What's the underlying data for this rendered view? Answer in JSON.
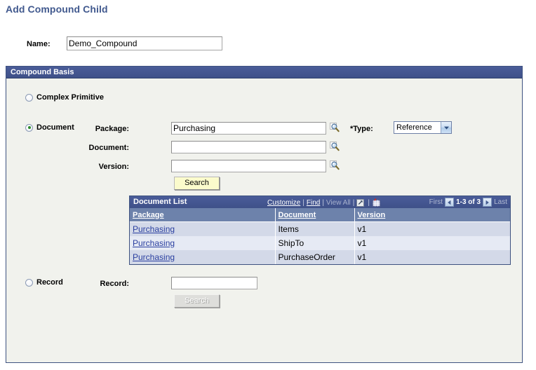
{
  "page": {
    "title": "Add Compound Child"
  },
  "name_field": {
    "label": "Name:",
    "value": "Demo_Compound",
    "placeholder": ""
  },
  "groupbox": {
    "title": "Compound Basis"
  },
  "options": {
    "complex_primitive": {
      "label": "Complex Primitive",
      "selected": false
    },
    "document": {
      "label": "Document",
      "selected": true
    },
    "record": {
      "label": "Record",
      "selected": false
    }
  },
  "document_section": {
    "package": {
      "label": "Package:",
      "value": "Purchasing",
      "placeholder": "",
      "lookup_icon": "magnifier-icon"
    },
    "document": {
      "label": "Document:",
      "value": "",
      "placeholder": "",
      "lookup_icon": "magnifier-icon"
    },
    "version": {
      "label": "Version:",
      "value": "",
      "placeholder": "",
      "lookup_icon": "magnifier-icon"
    },
    "type": {
      "label": "*Type:",
      "value": "Reference",
      "options": [
        "Reference"
      ],
      "arrow_icon": "chevron-down-icon"
    },
    "search_button": {
      "label": "Search",
      "enabled": true
    }
  },
  "record_section": {
    "record": {
      "label": "Record:",
      "value": "",
      "placeholder": ""
    },
    "search_button": {
      "label": "Search",
      "enabled": false
    }
  },
  "document_list": {
    "title": "Document List",
    "tools": {
      "customize": "Customize",
      "find": "Find",
      "view_all": "View All",
      "separator": "|",
      "expand_icon": "expand-grid-icon",
      "download_icon": "download-spreadsheet-icon"
    },
    "pager": {
      "first": "First",
      "prev_icon": "prev-page-icon",
      "range": "1-3 of 3",
      "next_icon": "next-page-icon",
      "last": "Last"
    },
    "columns": [
      "Package",
      "Document",
      "Version"
    ],
    "rows": [
      {
        "package": "Purchasing",
        "document": "Items",
        "version": "v1"
      },
      {
        "package": "Purchasing",
        "document": "ShipTo",
        "version": "v1"
      },
      {
        "package": "Purchasing",
        "document": "PurchaseOrder",
        "version": "v1"
      }
    ]
  },
  "colors": {
    "title_blue": "#41598e",
    "header_blue": "#435591",
    "panel_bg": "#f1f2ed",
    "grid_header_col": "#6d82ab",
    "row_odd": "#d3d9e8",
    "row_even": "#e6eaf4",
    "link_blue": "#2a3fa0",
    "button_yellow": "#fbfbcc"
  }
}
